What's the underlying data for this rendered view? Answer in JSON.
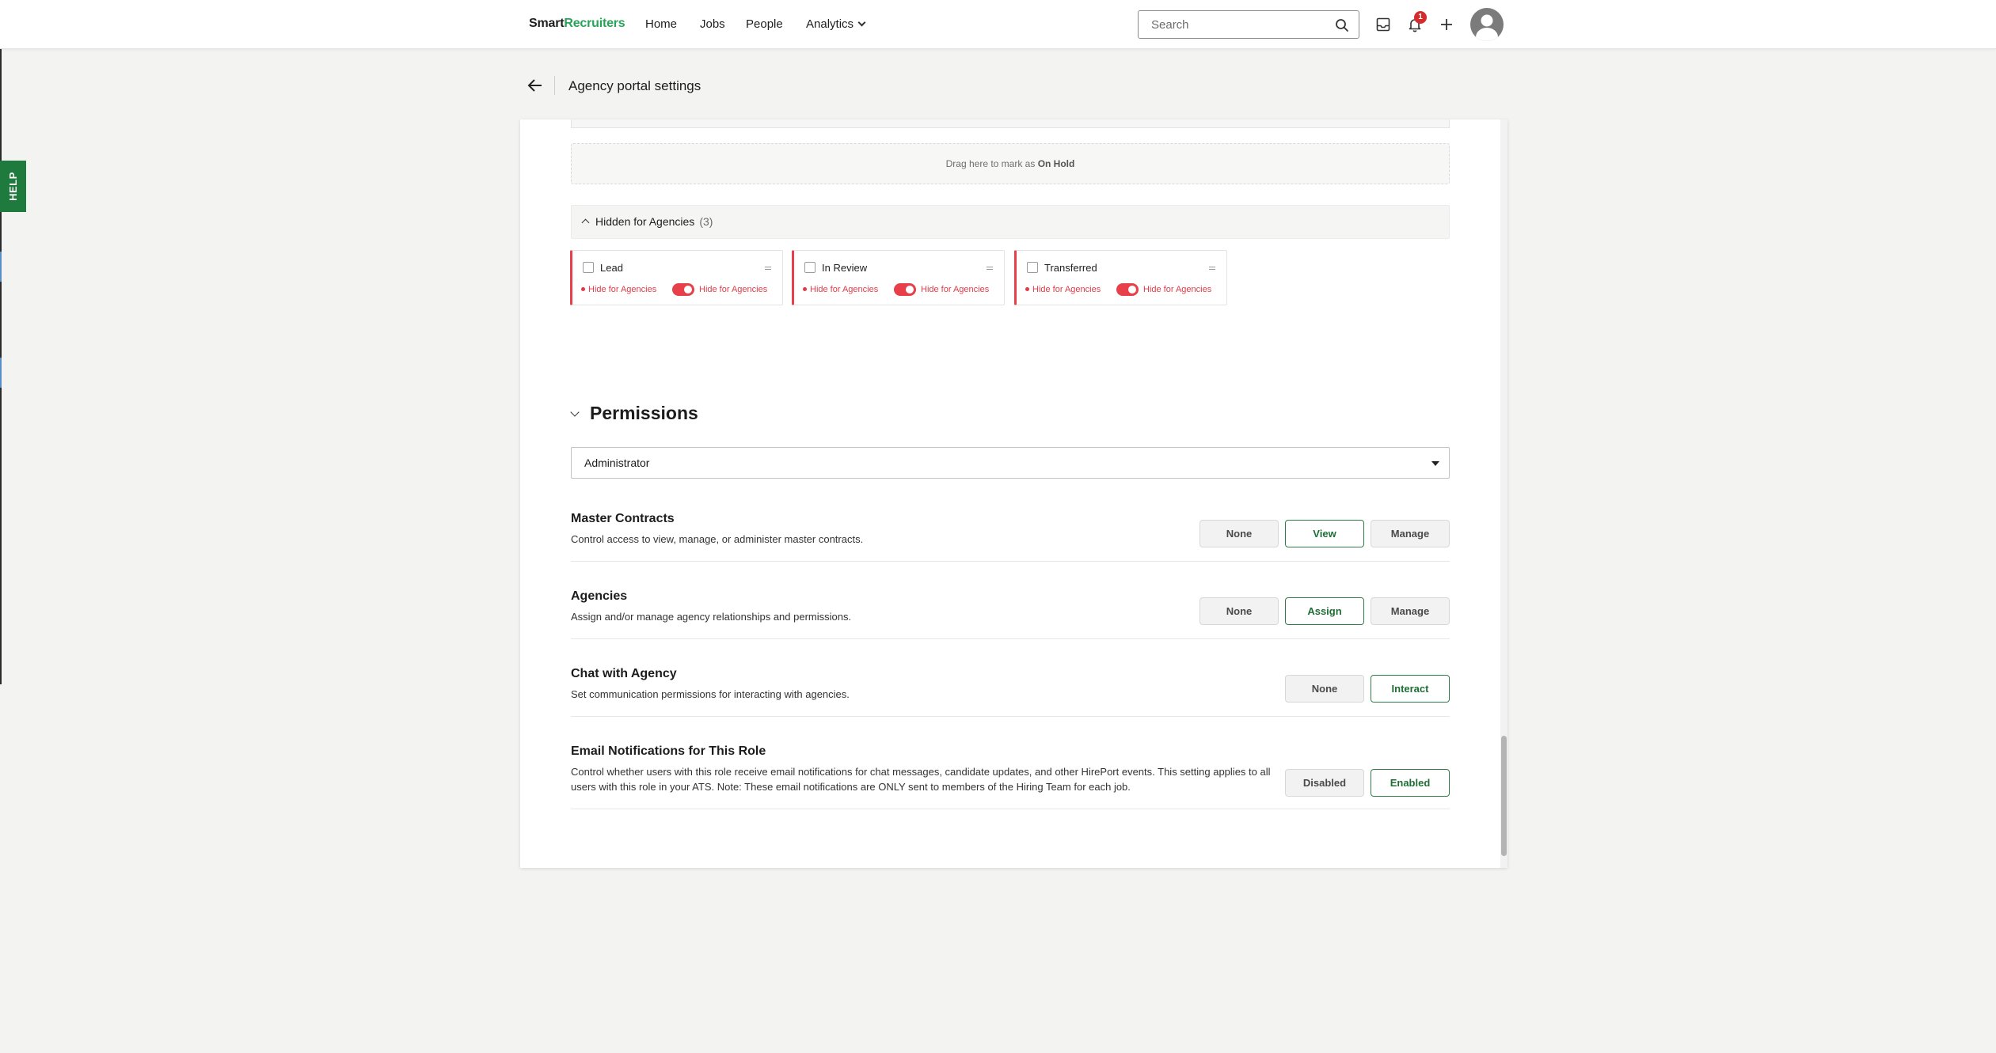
{
  "nav": {
    "brand_part1": "Smart",
    "brand_part2": "Recruiters",
    "items": [
      {
        "label": "Home"
      },
      {
        "label": "Jobs"
      },
      {
        "label": "People"
      },
      {
        "label": "Analytics"
      }
    ],
    "search_placeholder": "Search",
    "notification_count": "1",
    "icons": [
      "search-icon",
      "inbox-icon",
      "bell-icon",
      "plus-icon",
      "user-avatar-icon"
    ]
  },
  "help_tab": {
    "label": "HELP"
  },
  "header": {
    "title": "Agency portal settings"
  },
  "pipeline": {
    "drop_zone_prefix": "Drag here to mark as",
    "drop_zone_status": "On Hold",
    "hidden_section": {
      "label": "Hidden for Agencies",
      "count": "(3)"
    },
    "stages": [
      {
        "name": "Lead",
        "hide_label": "Hide for Agencies",
        "toggle_label": "Hide for Agencies",
        "toggle_on": true
      },
      {
        "name": "In Review",
        "hide_label": "Hide for Agencies",
        "toggle_label": "Hide for Agencies",
        "toggle_on": true
      },
      {
        "name": "Transferred",
        "hide_label": "Hide for Agencies",
        "toggle_label": "Hide for Agencies",
        "toggle_on": true
      }
    ]
  },
  "permissions": {
    "title": "Permissions",
    "role_selected": "Administrator",
    "rows": [
      {
        "title": "Master Contracts",
        "description": "Control access to view, manage, or administer master contracts.",
        "options": [
          "None",
          "View",
          "Manage"
        ],
        "selected": "View"
      },
      {
        "title": "Agencies",
        "description": "Assign and/or manage agency relationships and permissions.",
        "options": [
          "None",
          "Assign",
          "Manage"
        ],
        "selected": "Assign"
      },
      {
        "title": "Chat with Agency",
        "description": "Set communication permissions for interacting with agencies.",
        "options": [
          "None",
          "Interact"
        ],
        "selected": "Interact"
      },
      {
        "title": "Email Notifications for This Role",
        "description_line1": "Control whether users with this role receive email notifications for chat messages, candidate updates, and other HirePort events. This setting applies to all",
        "description_line2": "users with this role in your ATS. Note: These email notifications are ONLY sent to members of the Hiring Team for each job.",
        "options": [
          "Disabled",
          "Enabled"
        ],
        "selected": "Enabled"
      }
    ]
  },
  "colors": {
    "brand_green": "#29a35a",
    "selected_border": "#2f7d46",
    "hidden_red": "#e8404b",
    "help_green": "#1e7a3d"
  }
}
